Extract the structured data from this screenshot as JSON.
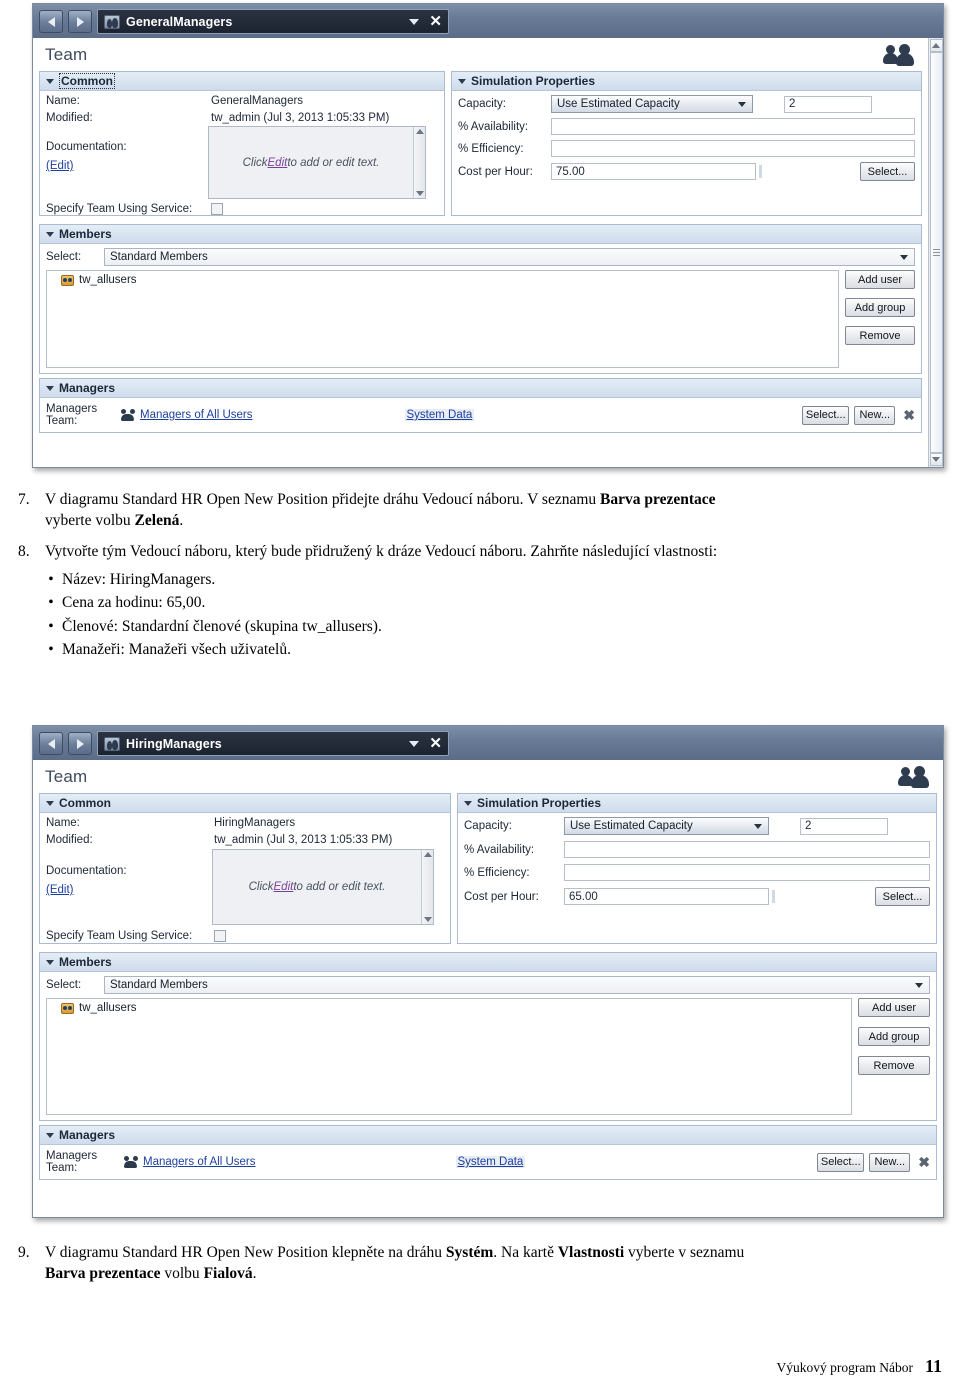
{
  "screenshot_1": {
    "titlebar": {
      "back_icon": "back-arrow-icon",
      "forward_icon": "forward-arrow-icon",
      "item_icon": "team-icon",
      "title": "GeneralManagers",
      "dropdown_icon": "chevron-down-icon",
      "close_icon": "close-icon"
    },
    "page_title": "Team",
    "header_icon": "team-people-icon",
    "common": {
      "header": "Common",
      "name_label": "Name:",
      "name_value": "GeneralManagers",
      "modified_label": "Modified:",
      "modified_value": "tw_admin (Jul 3, 2013 1:05:33 PM)",
      "documentation_label": "Documentation:",
      "edit_link": "(Edit)",
      "doc_placeholder_pre": "Click ",
      "doc_placeholder_link": "Edit",
      "doc_placeholder_post": " to add or edit text.",
      "specify_label": "Specify Team Using Service:",
      "specify_checked": false
    },
    "simulation": {
      "header": "Simulation Properties",
      "capacity_label": "Capacity:",
      "capacity_value": "Use Estimated Capacity",
      "capacity_number": "2",
      "availability_label": "% Availability:",
      "availability_value": "",
      "efficiency_label": "% Efficiency:",
      "efficiency_value": "",
      "cost_label": "Cost per Hour:",
      "cost_value": "75.00",
      "select_button": "Select..."
    },
    "members": {
      "header": "Members",
      "select_label": "Select:",
      "select_value": "Standard Members",
      "items": [
        "tw_allusers"
      ],
      "add_user_button": "Add user",
      "add_group_button": "Add group",
      "remove_button": "Remove"
    },
    "managers": {
      "header": "Managers",
      "team_label": "Managers Team:",
      "team_link": "Managers of All Users",
      "system_data": "System Data",
      "select_button": "Select...",
      "new_button": "New...",
      "clear_icon": "clear-x-icon"
    }
  },
  "screenshot_2": {
    "titlebar": {
      "back_icon": "back-arrow-icon",
      "forward_icon": "forward-arrow-icon",
      "item_icon": "team-icon",
      "title": "HiringManagers",
      "dropdown_icon": "chevron-down-icon",
      "close_icon": "close-icon"
    },
    "page_title": "Team",
    "header_icon": "team-people-icon",
    "common": {
      "header": "Common",
      "name_label": "Name:",
      "name_value": "HiringManagers",
      "modified_label": "Modified:",
      "modified_value": "tw_admin (Jul 3, 2013 1:05:33 PM)",
      "documentation_label": "Documentation:",
      "edit_link": "(Edit)",
      "doc_placeholder_pre": "Click ",
      "doc_placeholder_link": "Edit",
      "doc_placeholder_post": " to add or edit text.",
      "specify_label": "Specify Team Using Service:",
      "specify_checked": false
    },
    "simulation": {
      "header": "Simulation Properties",
      "capacity_label": "Capacity:",
      "capacity_value": "Use Estimated Capacity",
      "capacity_number": "2",
      "availability_label": "% Availability:",
      "availability_value": "",
      "efficiency_label": "% Efficiency:",
      "efficiency_value": "",
      "cost_label": "Cost per Hour:",
      "cost_value": "65.00",
      "select_button": "Select..."
    },
    "members": {
      "header": "Members",
      "select_label": "Select:",
      "select_value": "Standard Members",
      "items": [
        "tw_allusers"
      ],
      "add_user_button": "Add user",
      "add_group_button": "Add group",
      "remove_button": "Remove"
    },
    "managers": {
      "header": "Managers",
      "team_label": "Managers Team:",
      "team_link": "Managers of All Users",
      "system_data": "System Data",
      "select_button": "Select...",
      "new_button": "New...",
      "clear_icon": "clear-x-icon"
    }
  },
  "steps": {
    "step7": {
      "number": "7.",
      "line1_a": "V diagramu Standard HR Open New Position přidejte dráhu Vedoucí náboru. V seznamu ",
      "line1_b": "Barva prezentace",
      "line2_a": "vyberte volbu ",
      "line2_b": "Zelená",
      "line2_c": "."
    },
    "step8": {
      "number": "8.",
      "text": "Vytvořte tým Vedoucí náboru, který bude přidružený k dráze Vedoucí náboru. Zahrňte následující vlastnosti:",
      "bullets": [
        "Název: HiringManagers.",
        "Cena za hodinu: 65,00.",
        "Členové: Standardní členové (skupina tw_allusers).",
        "Manažeři: Manažeři všech uživatelů."
      ]
    },
    "step9": {
      "number": "9.",
      "l1_a": "V diagramu Standard HR Open New Position klepněte na dráhu ",
      "l1_b": "Systém",
      "l1_c": ". Na kartě ",
      "l1_d": "Vlastnosti",
      "l1_e": " vyberte v seznamu",
      "l2_a": "Barva prezentace",
      "l2_b": " volbu ",
      "l2_c": "Fialová",
      "l2_d": "."
    }
  },
  "footer": {
    "title": "Výukový program Nábor",
    "page_number": "11"
  },
  "colors": {
    "chrome": "#6e809b",
    "addressbar": "#1c2330",
    "section_header": "#cfdcec",
    "link": "#1d3fa0",
    "page_title": "#3f4a5c"
  }
}
